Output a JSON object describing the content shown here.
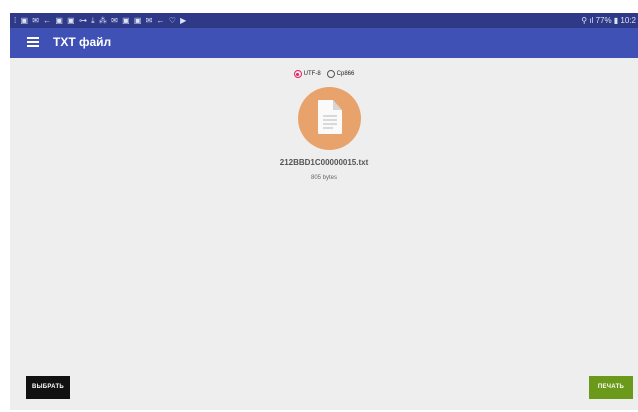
{
  "statusbar": {
    "left_icons": "⁞ ▣ ✉ ← ▣ ▣ ⊶ ⤓ ⁂ ✉ ▣ ▣ ✉ ← ♡ ▶",
    "right_text": "⚲ ıl 77% ▮ 10:2"
  },
  "appbar": {
    "title": "ТХТ файл"
  },
  "encoding": {
    "option_utf8": "UTF-8",
    "option_cp866": "Cp866",
    "selected": "UTF-8"
  },
  "file": {
    "name": "212BBD1C00000015.txt",
    "size": "805 bytes"
  },
  "buttons": {
    "choose_label": "ВЫБРАТЬ",
    "print_label": "ПЕЧАТЬ"
  },
  "colors": {
    "appbar": "#3f51b5",
    "statusbar": "#2e3a87",
    "radio_accent": "#e91e63",
    "file_circle": "#e8a36c",
    "choose_button": "#111111",
    "print_button": "#6b9a1b"
  },
  "icons": {
    "menu": "hamburger-icon",
    "file": "document-icon"
  }
}
